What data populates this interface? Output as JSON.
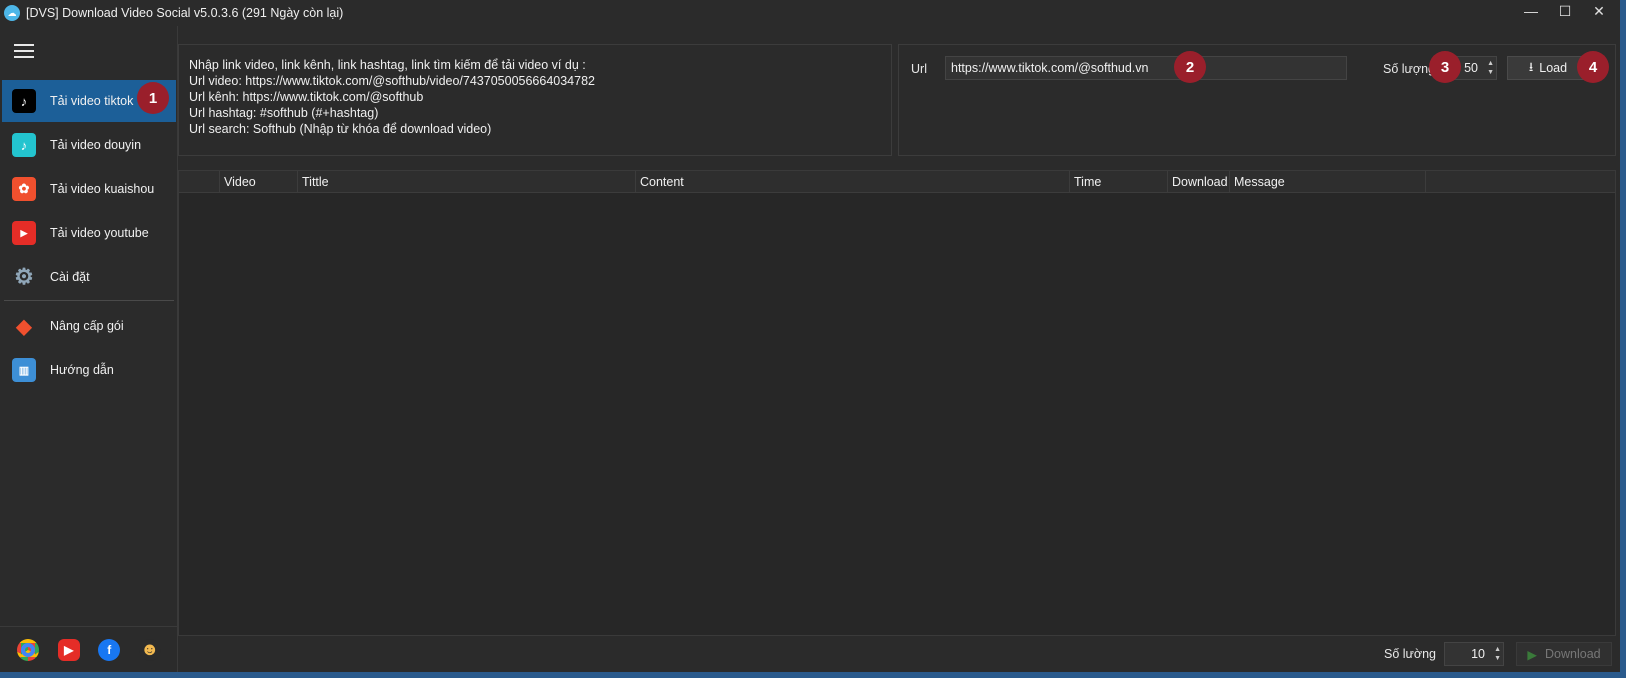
{
  "window": {
    "title": "[DVS] Download Video Social v5.0.3.6 (291 Ngày còn lại)",
    "controls": {
      "minimize": "—",
      "maximize": "☐",
      "close": "✕"
    }
  },
  "sidebar": {
    "items": [
      {
        "label": "Tải video tiktok",
        "icon": "tiktok-icon",
        "active": true
      },
      {
        "label": "Tải video douyin",
        "icon": "douyin-icon"
      },
      {
        "label": "Tải video kuaishou",
        "icon": "kuaishou-icon"
      },
      {
        "label": "Tải video youtube",
        "icon": "youtube-icon"
      },
      {
        "label": "Cài đặt",
        "icon": "gear-icon"
      },
      {
        "label": "Nâng cấp gói",
        "icon": "tag-icon"
      },
      {
        "label": "Hướng dẫn",
        "icon": "guide-icon"
      }
    ],
    "bottom_icons": [
      "chrome-icon",
      "youtube-shorts-icon",
      "facebook-icon",
      "support-agent-icon"
    ]
  },
  "info": {
    "lines": [
      "Nhập link video, link kênh, link hashtag, link tìm kiếm để tải video ví dụ :",
      "Url video: https://www.tiktok.com/@softhub/video/7437050056664034782",
      "Url kênh: https://www.tiktok.com/@softhub",
      "Url hashtag: #softhub (#+hashtag)",
      "Url search: Softhub (Nhập từ khóa để download video)"
    ]
  },
  "url_panel": {
    "url_label": "Url",
    "url_value": "https://www.tiktok.com/@softhud.vn",
    "quantity_label": "Số lượng",
    "quantity_value": "50",
    "load_label": "Load"
  },
  "badges": [
    "1",
    "2",
    "3",
    "4"
  ],
  "table": {
    "columns": [
      "",
      "Video",
      "Tittle",
      "Content",
      "Time",
      "Download",
      "Message"
    ]
  },
  "footer": {
    "quantity_label": "Số lường",
    "quantity_value": "10",
    "download_label": "Download"
  },
  "colors": {
    "active_nav": "#1c5f98",
    "badge": "#9a1f2b",
    "background": "#2b2b2b"
  }
}
